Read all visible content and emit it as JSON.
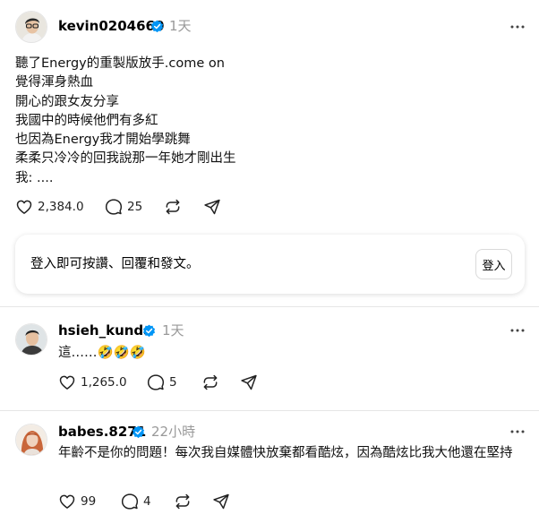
{
  "main_post": {
    "username": "kevin0204660",
    "time": "1天",
    "text": "聽了Energy的重製版放手.come on\n覺得渾身熱血\n開心的跟女友分享\n我國中的時候他們有多紅\n也因為Energy我才開始學跳舞\n柔柔只冷冷的回我說那一年她才剛出生\n我: ....",
    "likes": "2,384.0",
    "comments": "25"
  },
  "login_prompt": {
    "text": "登入即可按讚、回覆和發文。",
    "button_label": "登入"
  },
  "replies": [
    {
      "username": "hsieh_kunda",
      "time": "1天",
      "text": "這……🤣🤣🤣",
      "likes": "1,265.0",
      "comments": "5"
    },
    {
      "username": "babes.8271",
      "time": "22小時",
      "text": "年齡不是你的問題！每次我自媒體快放棄都看酷炫，因為酷炫比我大他還在堅持",
      "likes": "99",
      "comments": "4"
    }
  ],
  "colors": {
    "verified": "#0095f6",
    "muted_text": "#999999",
    "divider": "#e6e6e6"
  }
}
